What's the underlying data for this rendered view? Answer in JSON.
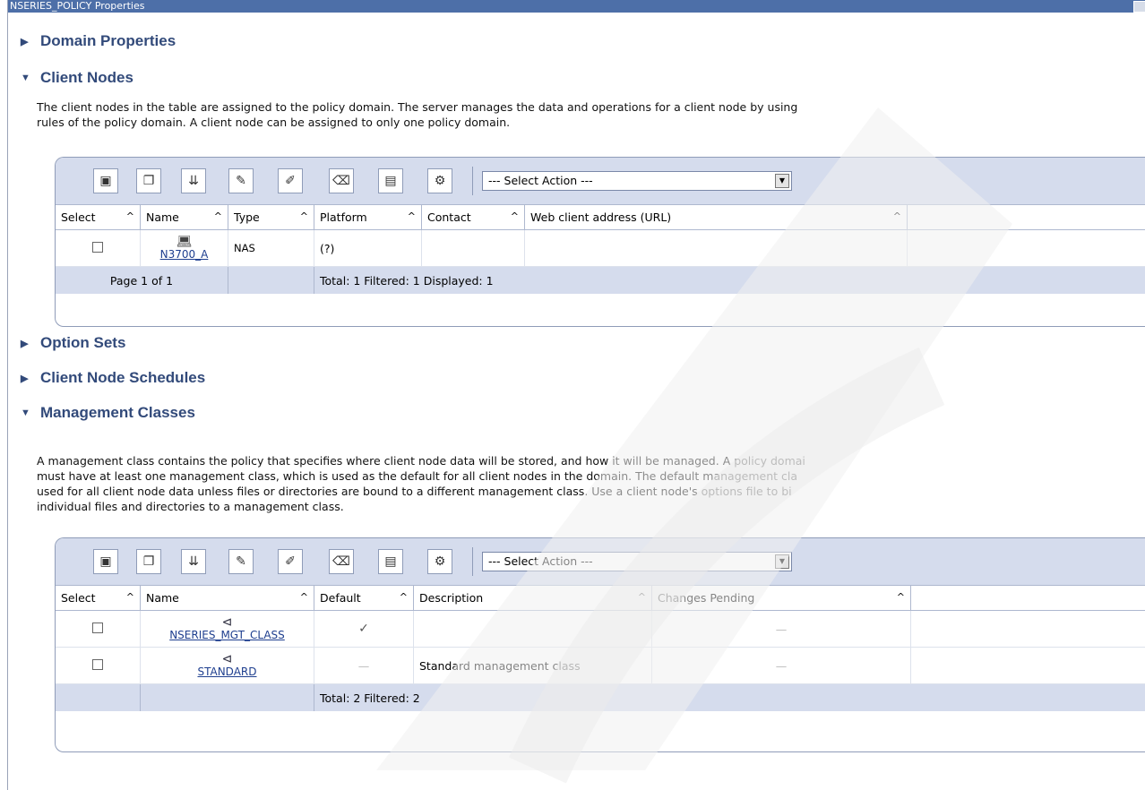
{
  "window": {
    "title": "NSERIES_POLICY Properties"
  },
  "sections": {
    "domain_properties": "Domain Properties",
    "client_nodes": "Client Nodes",
    "option_sets": "Option Sets",
    "client_node_schedules": "Client Node Schedules",
    "management_classes": "Management Classes"
  },
  "client_nodes": {
    "description_lines": [
      "The client nodes in the table are assigned to the policy domain. The server manages the data and operations for a client node by using",
      "rules of the policy domain. A client node can be assigned to only one policy domain."
    ],
    "select_action": "--- Select Action ---",
    "columns": [
      "Select",
      "Name",
      "Type",
      "Platform",
      "Contact",
      "Web client address (URL)"
    ],
    "rows": [
      {
        "name": "N3700_A",
        "type": "NAS",
        "platform": "(?)",
        "contact": "",
        "url": ""
      }
    ],
    "footer": {
      "page": "Page 1 of 1",
      "summary": "Total: 1   Filtered: 1   Displayed: 1"
    }
  },
  "management_classes": {
    "description_lines": [
      "A management class contains the policy that specifies where client node data will be stored, and how it will be managed. A policy domai",
      "must have at least one management class, which is used as the default for all client nodes in the domain. The default management cla",
      "used for all client node data unless files or directories are bound to a different management class. Use a client node's options file to bi",
      "individual files and directories to a management class."
    ],
    "select_action": "--- Select Action ---",
    "columns": [
      "Select",
      "Name",
      "Default",
      "Description",
      "Changes Pending"
    ],
    "rows": [
      {
        "name": "NSERIES_MGT_CLASS",
        "default": "✓",
        "description": "",
        "changes_pending": "—"
      },
      {
        "name": "STANDARD",
        "default": "—",
        "description": "Standard management class",
        "changes_pending": "—"
      }
    ],
    "footer": {
      "summary": "Total: 2   Filtered: 2"
    }
  },
  "sort_icon": "^",
  "colors": {
    "section_heading": "#324a7a",
    "toolbar_bg": "#d5dced",
    "link": "#1f3f8f",
    "titlebar": "#4d6fa8"
  }
}
